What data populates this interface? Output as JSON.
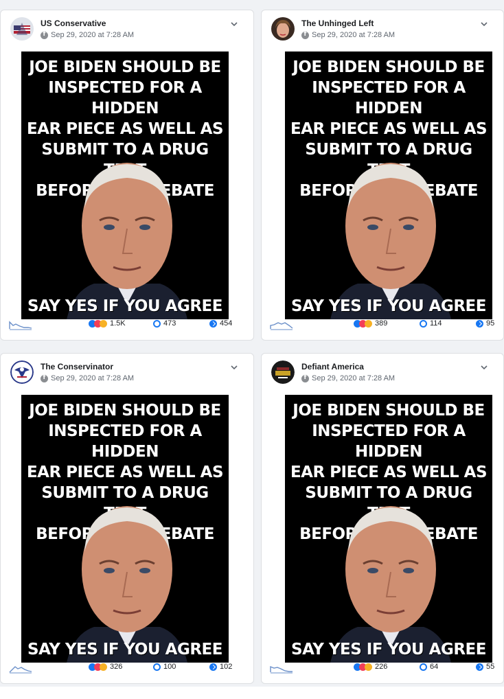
{
  "meme": {
    "top_lines": [
      "JOE BIDEN SHOULD BE",
      "INSPECTED FOR A HIDDEN",
      "EAR PIECE AS WELL AS",
      "SUBMIT TO A DRUG TEST",
      "BEFORE THE DEBATE"
    ],
    "bottom": "SAY YES IF YOU AGREE"
  },
  "posts": [
    {
      "page": "US Conservative",
      "date": "Sep 29, 2020 at 7:28 AM",
      "reactions": "1.5K",
      "comments": "473",
      "shares": "454"
    },
    {
      "page": "The Unhinged Left",
      "date": "Sep 29, 2020 at 7:28 AM",
      "reactions": "389",
      "comments": "114",
      "shares": "95"
    },
    {
      "page": "The Conservinator",
      "date": "Sep 29, 2020 at 7:28 AM",
      "reactions": "326",
      "comments": "100",
      "shares": "102"
    },
    {
      "page": "Defiant America",
      "date": "Sep 29, 2020 at 7:28 AM",
      "reactions": "226",
      "comments": "64",
      "shares": "55"
    }
  ],
  "icons": {
    "platform": "facebook-icon",
    "menu": "chevron-down-icon",
    "comments": "comment-icon",
    "shares": "share-icon",
    "trend": "sparkline-icon"
  },
  "colors": {
    "accent": "#1877f2",
    "love": "#f33e58",
    "haha": "#f7b125",
    "meme_bg": "#000000"
  }
}
